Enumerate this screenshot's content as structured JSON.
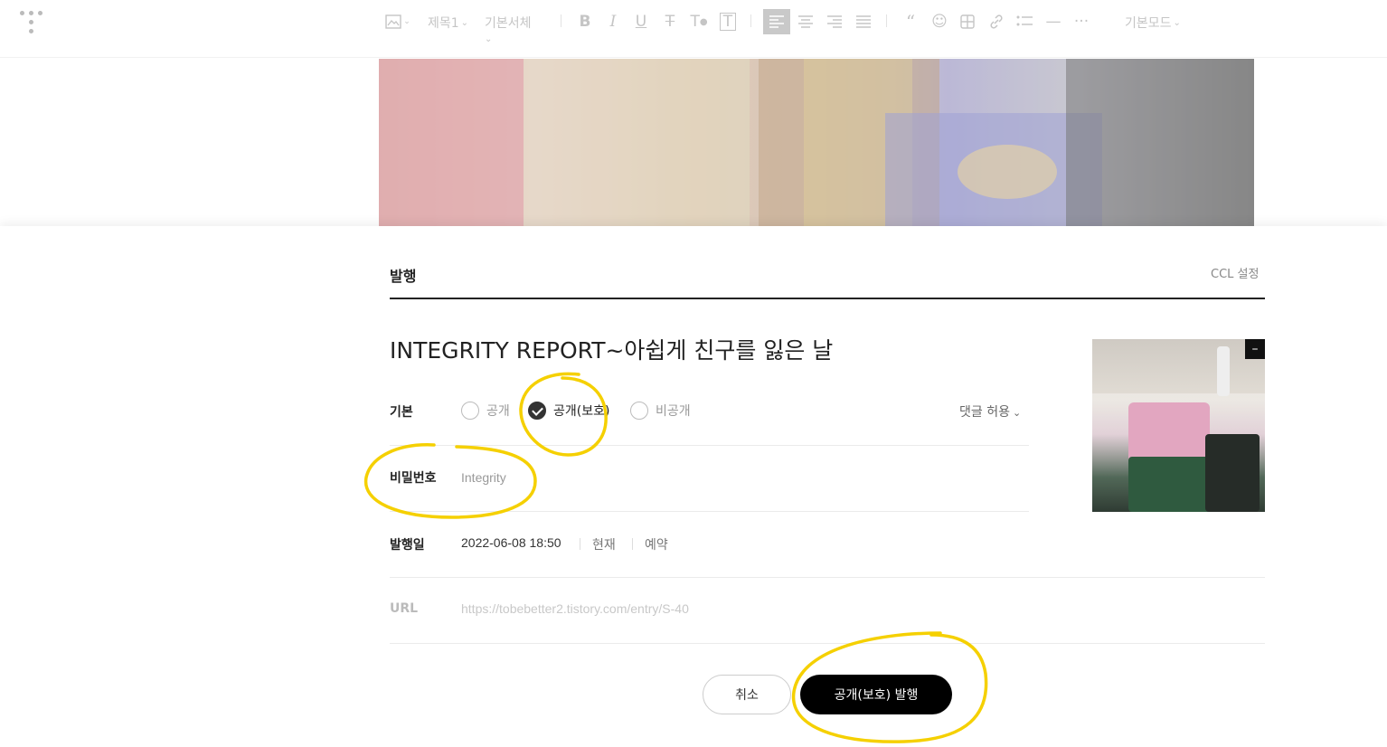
{
  "toolbar": {
    "image_icon": "image-icon",
    "heading_label": "제목1",
    "font_label": "기본서체",
    "mode_label": "기본모드",
    "buttons": [
      "bold",
      "italic",
      "underline",
      "strikethrough",
      "text-color",
      "text-background",
      "align-left",
      "align-center",
      "align-right",
      "align-justify",
      "quote",
      "emoticon",
      "table",
      "link",
      "list",
      "divider",
      "more"
    ]
  },
  "panel": {
    "title": "발행",
    "ccl_label": "CCL 설정",
    "post_title": "INTEGRITY REPORT~아쉽게 친구를 잃은 날",
    "visibility": {
      "label": "기본",
      "options": [
        "공개",
        "공개(보호)",
        "비공개"
      ],
      "selected": "공개(보호)"
    },
    "comment_option": "댓글 허용",
    "password": {
      "label": "비밀번호",
      "value": "Integrity"
    },
    "publish_date": {
      "label": "발행일",
      "value": "2022-06-08 18:50",
      "now_label": "현재",
      "reserve_label": "예약"
    },
    "url": {
      "label": "URL",
      "value": "https://tobebetter2.tistory.com/entry/S-40"
    },
    "thumbnail_delete": "–",
    "cancel_button": "취소",
    "publish_button": "공개(보호) 발행"
  },
  "colors": {
    "highlight": "#f5d000",
    "primary_button": "#000000"
  }
}
